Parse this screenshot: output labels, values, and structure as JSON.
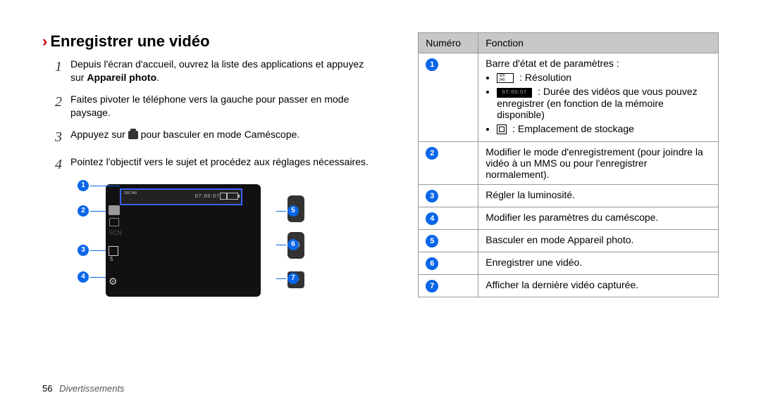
{
  "heading": "Enregistrer une vidéo",
  "heading_chevron": "›",
  "steps": [
    {
      "num": "1",
      "pre": "Depuis l'écran d'accueil, ouvrez la liste des applications et appuyez sur ",
      "bold": "Appareil photo",
      "post": "."
    },
    {
      "num": "2",
      "pre": "Faites pivoter le téléphone vers la gauche pour passer en mode paysage."
    },
    {
      "num": "3",
      "pre": "Appuyez sur ",
      "icon": "camera-icon",
      "post": " pour basculer en mode Caméscope."
    },
    {
      "num": "4",
      "pre": "Pointez l'objectif vers le sujet et procédez aux réglages nécessaires."
    }
  ],
  "diagram": {
    "res": "320\n240",
    "time": "07:00:07",
    "scn": "SCN",
    "ev": "5",
    "preview_glyph": "▶",
    "callouts": [
      "1",
      "2",
      "3",
      "4",
      "5",
      "6",
      "7"
    ]
  },
  "table": {
    "head": {
      "num": "Numéro",
      "func": "Fonction"
    },
    "rows": [
      {
        "n": "1",
        "type": "list",
        "intro": "Barre d'état et de paramètres :",
        "items": [
          {
            "icon": "res",
            "text": ": Résolution"
          },
          {
            "icon": "time",
            "text": ": Durée des vidéos que vous pouvez enregistrer (en fonction de la mémoire disponible)"
          },
          {
            "icon": "card",
            "text": ": Emplacement de stockage"
          }
        ]
      },
      {
        "n": "2",
        "text": "Modifier le mode d'enregistrement (pour joindre la vidéo à un MMS ou pour l'enregistrer normalement)."
      },
      {
        "n": "3",
        "text": "Régler la luminosité."
      },
      {
        "n": "4",
        "text": "Modifier les paramètres du caméscope."
      },
      {
        "n": "5",
        "text": "Basculer en mode Appareil photo."
      },
      {
        "n": "6",
        "text": "Enregistrer une vidéo."
      },
      {
        "n": "7",
        "text": "Afficher la dernière vidéo capturée."
      }
    ]
  },
  "footer": {
    "page": "56",
    "chapter": "Divertissements"
  }
}
